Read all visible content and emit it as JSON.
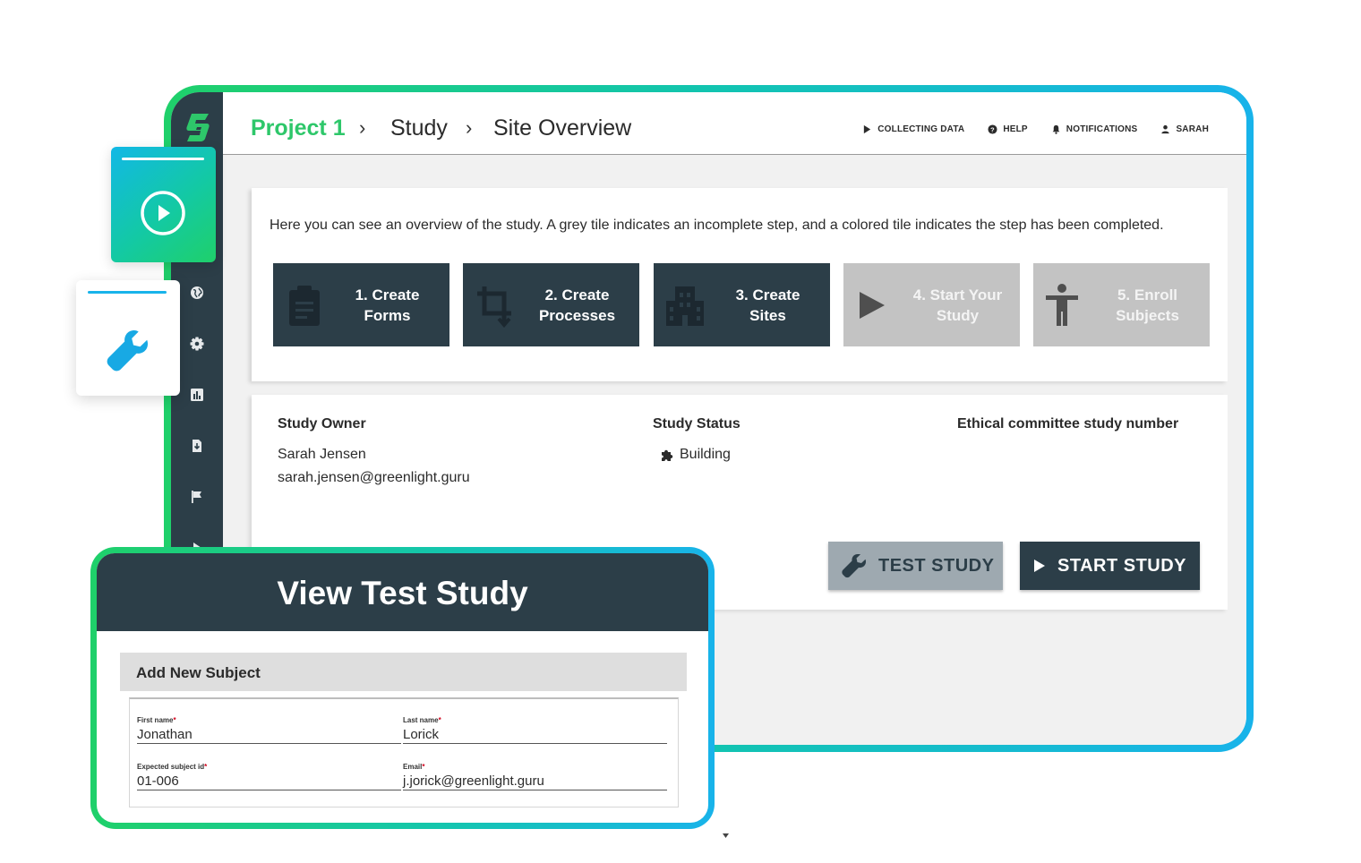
{
  "breadcrumb": {
    "project": "Project 1",
    "study": "Study",
    "page": "Site Overview",
    "separator": "›"
  },
  "top_actions": [
    {
      "label": "COLLECTING DATA",
      "icon": "play-icon"
    },
    {
      "label": "HELP",
      "icon": "help-icon"
    },
    {
      "label": "NOTIFICATIONS",
      "icon": "bell-icon"
    },
    {
      "label": "SARAH",
      "icon": "user-icon"
    }
  ],
  "sidebar": {
    "icons": [
      "globe-icon",
      "gear-icon",
      "chart-icon",
      "download-icon",
      "flag-icon",
      "play-icon"
    ]
  },
  "overview": {
    "description": "Here you can see an overview of the study. A grey tile indicates an incomplete step, and a colored tile indicates the step has been completed.",
    "tiles": [
      {
        "line1": "1. Create",
        "line2": "Forms",
        "icon": "clipboard-icon",
        "completed": true
      },
      {
        "line1": "2. Create",
        "line2": "Processes",
        "icon": "crop-icon",
        "completed": true
      },
      {
        "line1": "3. Create",
        "line2": "Sites",
        "icon": "building-icon",
        "completed": true
      },
      {
        "line1": "4. Start Your",
        "line2": "Study",
        "icon": "play-icon",
        "completed": false
      },
      {
        "line1": "5. Enroll",
        "line2": "Subjects",
        "icon": "person-icon",
        "completed": false
      }
    ]
  },
  "study_info": {
    "owner_label": "Study Owner",
    "owner_name": "Sarah Jensen",
    "owner_email": "sarah.jensen@greenlight.guru",
    "status_label": "Study Status",
    "status_value": "Building",
    "ethics_label": "Ethical committee study number"
  },
  "buttons": {
    "test_study": "TEST STUDY",
    "start_study": "START STUDY"
  },
  "test_study_panel": {
    "title": "View Test Study",
    "section_title": "Add New Subject",
    "fields": {
      "first_name": {
        "label": "First name",
        "value": "Jonathan"
      },
      "last_name": {
        "label": "Last name",
        "value": "Lorick"
      },
      "expected_id": {
        "label": "Expected subject id",
        "value": "01-006"
      },
      "email": {
        "label": "Email",
        "value": "j.jorick@greenlight.guru"
      }
    },
    "required_mark": "*"
  },
  "colors": {
    "brand_green": "#2ec76a",
    "dark_slate": "#2c3e48",
    "incomplete_grey": "#c3c3c3",
    "frame_gradient_start": "#1fd06a",
    "frame_gradient_end": "#18b3ea"
  }
}
